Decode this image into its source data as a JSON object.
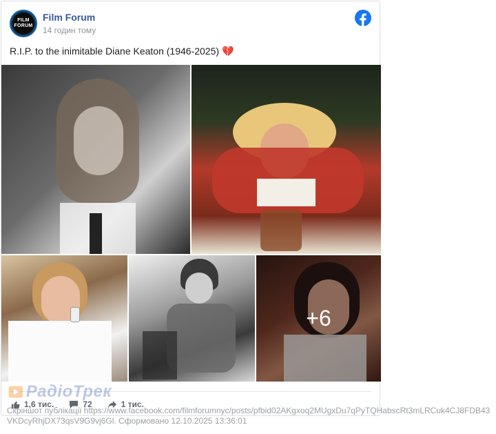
{
  "post": {
    "page_name": "Film Forum",
    "timestamp": "14 годин тому",
    "text": "R.I.P. to the inimitable Diane Keaton (1946-2025)",
    "emoji": "💔",
    "avatar_text_top": "FILM",
    "avatar_text_bottom": "FORUM",
    "more_photos": "+6"
  },
  "stats": {
    "likes": "1,6 тис.",
    "comments": "72",
    "shares": "1 тис."
  },
  "watermark": {
    "text": "РадіоТрек"
  },
  "caption": {
    "text": "Скріншот публікації https://www.facebook.com/filmforumnyc/posts/pfbid02AKgxoq2MUgxDu7qPyTQHabscRt3mLRCuk4CJ8FDB43VKDcyRhjDX73qsV9G9vj6Gl. Сформовано 12.10.2025 13:36:01"
  },
  "colors": {
    "page_name": "#385898",
    "facebook_blue": "#1877f2",
    "meta_text": "#90949c"
  },
  "icons": [
    "facebook-logo-icon",
    "like-thumb-icon",
    "comment-bubble-icon",
    "share-arrow-icon"
  ]
}
